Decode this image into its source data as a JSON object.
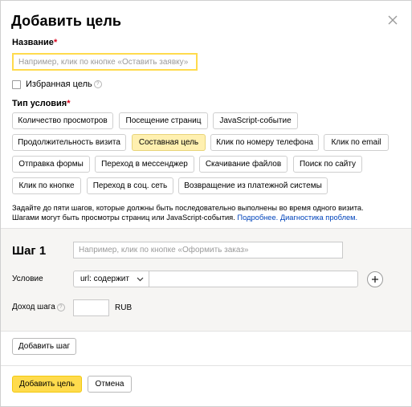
{
  "dialog": {
    "title": "Добавить цель",
    "close_icon": "close-icon"
  },
  "name_field": {
    "label": "Название",
    "required_mark": "*",
    "placeholder": "Например, клик по кнопке «Оставить заявку»"
  },
  "favorite": {
    "label": "Избранная цель",
    "checked": false,
    "help_icon": "question-icon"
  },
  "condition_type": {
    "label": "Тип условия",
    "required_mark": "*",
    "options": [
      {
        "label": "Количество просмотров",
        "selected": false
      },
      {
        "label": "Посещение страниц",
        "selected": false
      },
      {
        "label": "JavaScript-событие",
        "selected": false
      },
      {
        "label": "Продолжительность визита",
        "selected": false
      },
      {
        "label": "Составная цель",
        "selected": true
      },
      {
        "label": "Клик по номеру телефона",
        "selected": false
      },
      {
        "label": "Клик по email",
        "selected": false
      },
      {
        "label": "Отправка формы",
        "selected": false
      },
      {
        "label": "Переход в мессенджер",
        "selected": false
      },
      {
        "label": "Скачивание файлов",
        "selected": false
      },
      {
        "label": "Поиск по сайту",
        "selected": false
      },
      {
        "label": "Клик по кнопке",
        "selected": false
      },
      {
        "label": "Переход в соц. сеть",
        "selected": false
      },
      {
        "label": "Возвращение из платежной системы",
        "selected": false
      }
    ]
  },
  "description": {
    "line1": "Задайте до пяти шагов, которые должны быть последовательно выполнены во время одного визита.",
    "line2": "Шагами могут быть просмотры страниц или JavaScript-события.",
    "link_more": "Подробнее.",
    "link_diagnostics": "Диагностика проблем."
  },
  "step": {
    "title": "Шаг 1",
    "name_placeholder": "Например, клик по кнопке «Оформить заказ»",
    "condition_label": "Условие",
    "condition_select": "url: содержит",
    "condition_value": "",
    "add_condition_icon": "plus-icon",
    "income_label": "Доход шага",
    "income_value": "",
    "currency": "RUB"
  },
  "buttons": {
    "add_step": "Добавить шаг",
    "submit": "Добавить цель",
    "cancel": "Отмена"
  },
  "colors": {
    "accent": "#ffdb4d",
    "selected_chip": "#fff0b0",
    "link": "#0044bb",
    "required": "#d9001b",
    "section_bg": "#f6f5f3"
  }
}
